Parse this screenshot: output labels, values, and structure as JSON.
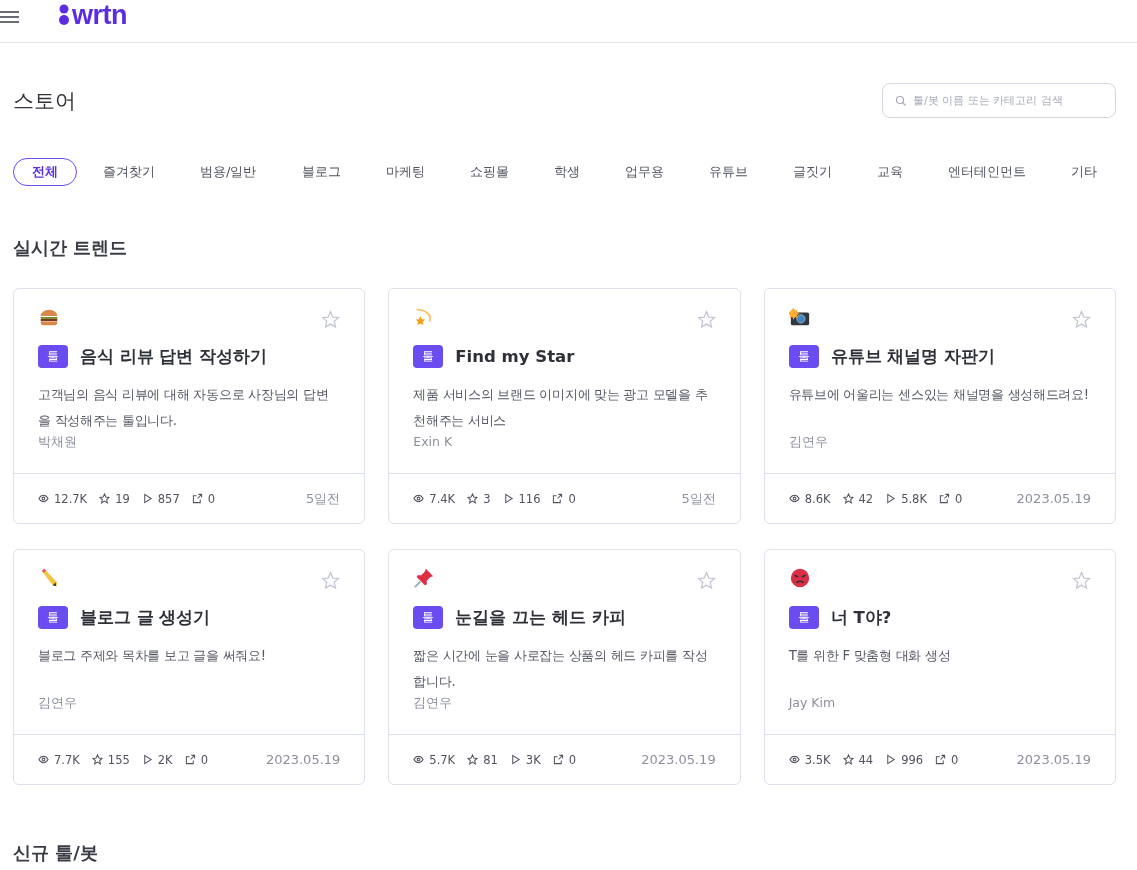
{
  "header": {
    "logo": "wrtn"
  },
  "page_title": "스토어",
  "search": {
    "placeholder": "툴/봇 이름 또는 카테고리 검색"
  },
  "tabs": [
    {
      "label": "전체",
      "selected": true
    },
    {
      "label": "즐겨찾기",
      "selected": false
    },
    {
      "label": "범용/일반",
      "selected": false
    },
    {
      "label": "블로그",
      "selected": false
    },
    {
      "label": "마케팅",
      "selected": false
    },
    {
      "label": "쇼핑몰",
      "selected": false
    },
    {
      "label": "학생",
      "selected": false
    },
    {
      "label": "업무용",
      "selected": false
    },
    {
      "label": "유튜브",
      "selected": false
    },
    {
      "label": "글짓기",
      "selected": false
    },
    {
      "label": "교육",
      "selected": false
    },
    {
      "label": "엔터테인먼트",
      "selected": false
    },
    {
      "label": "기타",
      "selected": false
    }
  ],
  "trend_section": {
    "title": "실시간 트렌드",
    "cards": [
      {
        "kind": "burger",
        "starred": false,
        "badge": "툴",
        "title": "음식 리뷰 답변 작성하기",
        "description": "고객님의 음식 리뷰에 대해 자동으로 사장님의 답변을 작성해주는 툴입니다.",
        "author": "박채원",
        "views": "12.7K",
        "stars": "19",
        "runs": "857",
        "shares": "0",
        "date": "5일전"
      },
      {
        "kind": "shooting-star",
        "starred": false,
        "badge": "툴",
        "title": "Find my Star",
        "description": "제품 서비스의 브랜드 이미지에 맞는 광고 모델을 추천해주는 서비스",
        "author": "Exin K",
        "views": "7.4K",
        "stars": "3",
        "runs": "116",
        "shares": "0",
        "date": "5일전"
      },
      {
        "kind": "camera",
        "starred": false,
        "badge": "툴",
        "title": "유튜브 채널명 자판기",
        "description": "유튜브에 어울리는 센스있는 채널명을 생성해드려요!",
        "author": "김연우",
        "views": "8.6K",
        "stars": "42",
        "runs": "5.8K",
        "shares": "0",
        "date": "2023.05.19"
      },
      {
        "kind": "pencil",
        "starred": false,
        "badge": "툴",
        "title": "블로그 글 생성기",
        "description": "블로그 주제와 목차를 보고 글을 써줘요!",
        "author": "김연우",
        "views": "7.7K",
        "stars": "155",
        "runs": "2K",
        "shares": "0",
        "date": "2023.05.19"
      },
      {
        "kind": "pin",
        "starred": false,
        "badge": "툴",
        "title": "눈길을 끄는 헤드 카피",
        "description": "짧은 시간에 눈을 사로잡는 상품의 헤드 카피를 작성합니다.",
        "author": "김연우",
        "views": "5.7K",
        "stars": "81",
        "runs": "3K",
        "shares": "0",
        "date": "2023.05.19"
      },
      {
        "kind": "angry",
        "starred": false,
        "badge": "툴",
        "title": "너 T야?",
        "description": "T를 위한 F 맞춤형 대화 생성",
        "author": "Jay Kim",
        "views": "3.5K",
        "stars": "44",
        "runs": "996",
        "shares": "0",
        "date": "2023.05.19"
      }
    ]
  },
  "new_section": {
    "title": "신규 툴/봇"
  }
}
